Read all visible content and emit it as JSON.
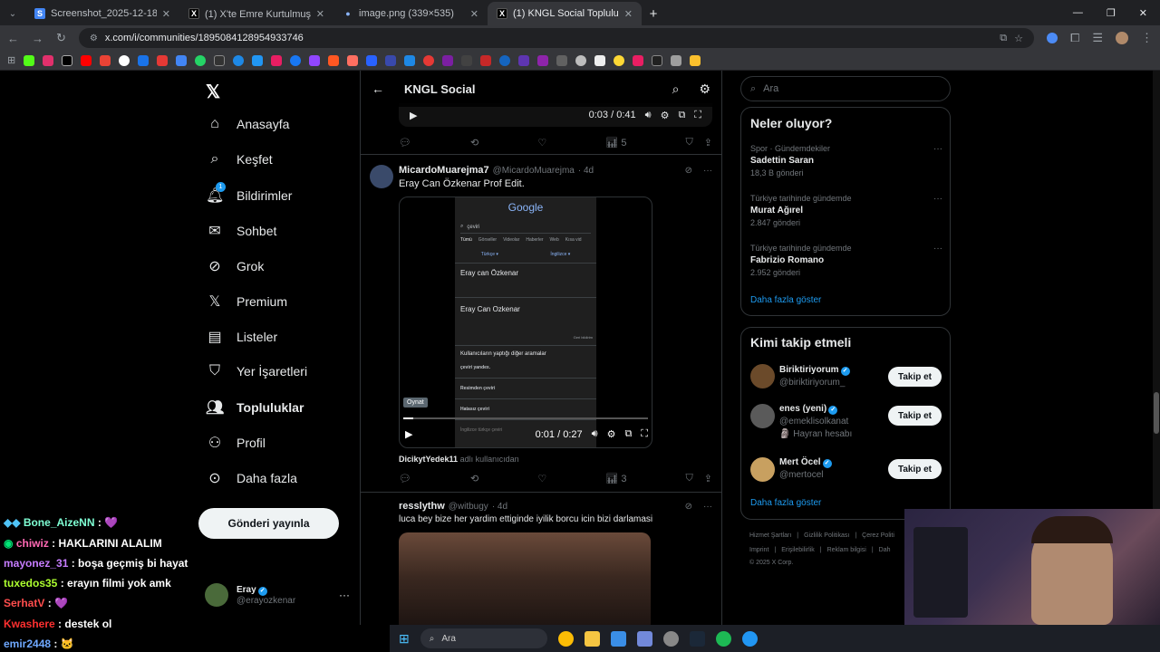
{
  "browser": {
    "tabs": [
      {
        "label": "Screenshot_2025-12-18-12-29-…",
        "fav": "S",
        "color": "#4285f4"
      },
      {
        "label": "(1) X'te Emre Kurtulmuş: \"🎉 O…",
        "fav": "X",
        "color": "#000000"
      },
      {
        "label": "image.png (339×535)",
        "fav": "●",
        "color": "#8ab4f8"
      },
      {
        "label": "(1) KNGL Social Topluluk / X",
        "fav": "X",
        "color": "#000000"
      }
    ],
    "url": "x.com/i/communities/1895084128954933746"
  },
  "nav": {
    "home": "Anasayfa",
    "explore": "Keşfet",
    "notifications": "Bildirimler",
    "notif_count": "1",
    "chat": "Sohbet",
    "grok": "Grok",
    "premium": "Premium",
    "lists": "Listeler",
    "bookmarks": "Yer İşaretleri",
    "communities": "Topluluklar",
    "profile": "Profil",
    "more": "Daha fazla",
    "post": "Gönderi yayınla"
  },
  "account": {
    "name": "Eray",
    "handle": "@erayozkenar"
  },
  "header": {
    "title": "KNGL Social"
  },
  "video1": {
    "time": "0:03 / 0:41",
    "views": "5"
  },
  "tweet1": {
    "name": "MicardoMuarejma7",
    "handle": "@MicardoMuarejma",
    "time": "· 4d",
    "text": "Eray Can Özkenar Prof Edit.",
    "video_time": "0:01 / 0:27",
    "play_label": "Oynat",
    "views": "3",
    "caption_name": "DicikytYedek11",
    "caption_suffix": "adlı kullanıcıdan"
  },
  "google_shot": {
    "logo": "Google",
    "query": "çeviri",
    "tabs": [
      "Tümü",
      "Görseller",
      "Videolar",
      "Haberler",
      "Web",
      "Kısa vid"
    ],
    "from_lang": "Türkçe ▾",
    "to_lang": "İngilizce ▾",
    "source_text": "Eray can Özkenar",
    "target_text": "Eray Can Ozkenar",
    "feedback": "Geri bildirim",
    "related_title": "Kullanıcıların yaptığı diğer aramalar",
    "related": [
      "çeviri yandex.",
      "Resimden çeviri",
      "Hatasız çeviri",
      "İngilizce türkçe çeviri"
    ]
  },
  "tweet2": {
    "name": "resslythw",
    "handle": "@witbugy",
    "time": "· 4d",
    "text": "luca bey bize her yardim ettiginde iyilik borcu icin bizi darlamasi"
  },
  "search": {
    "placeholder": "Ara"
  },
  "trends": {
    "title": "Neler oluyor?",
    "items": [
      {
        "context": "Spor · Gündemdekiler",
        "name": "Sadettin Saran",
        "count": "18,3 B gönderi"
      },
      {
        "context": "Türkiye tarihinde gündemde",
        "name": "Murat Ağırel",
        "count": "2.847 gönderi"
      },
      {
        "context": "Türkiye tarihinde gündemde",
        "name": "Fabrizio Romano",
        "count": "2.952 gönderi"
      }
    ],
    "more": "Daha fazla göster"
  },
  "who_to_follow": {
    "title": "Kimi takip etmeli",
    "items": [
      {
        "name": "Biriktiriyorum",
        "handle": "@biriktiriyorum_",
        "extra": ""
      },
      {
        "name": "enes (yeni)",
        "handle": "@emeklisolkanat",
        "extra": "🗿 Hayran hesabı"
      },
      {
        "name": "Mert Öcel",
        "handle": "@mertocel",
        "extra": ""
      }
    ],
    "follow_label": "Takip et",
    "more": "Daha fazla göster"
  },
  "footer": {
    "links": [
      "Hizmet Şartları",
      "|",
      "Gizlilik Politikası",
      "|",
      "Çerez Politi"
    ],
    "links2": [
      "Imprint",
      "|",
      "Erişilebilirlik",
      "|",
      "Reklam bilgisi",
      "|",
      "Dah"
    ],
    "copyright": "© 2025 X Corp."
  },
  "chat": [
    {
      "user": "Bone_AizeNN",
      "color": "#7fffd4",
      "msg": "💜"
    },
    {
      "user": "chiwiz",
      "color": "#ff69b4",
      "msg": "HAKLARINI ALALIM"
    },
    {
      "user": "mayonez_31",
      "color": "#c77dff",
      "msg": "boşa geçmiş bi hayat"
    },
    {
      "user": "tuxedos35",
      "color": "#adff2f",
      "msg": "erayın filmi yok amk"
    },
    {
      "user": "SerhatV",
      "color": "#ff4d4d",
      "msg": "💜"
    },
    {
      "user": "Kwashere",
      "color": "#ff3030",
      "msg": "destek ol"
    },
    {
      "user": "emir2448",
      "color": "#6fa8ff",
      "msg": "🐱"
    }
  ],
  "taskbar": {
    "search": "Ara"
  }
}
